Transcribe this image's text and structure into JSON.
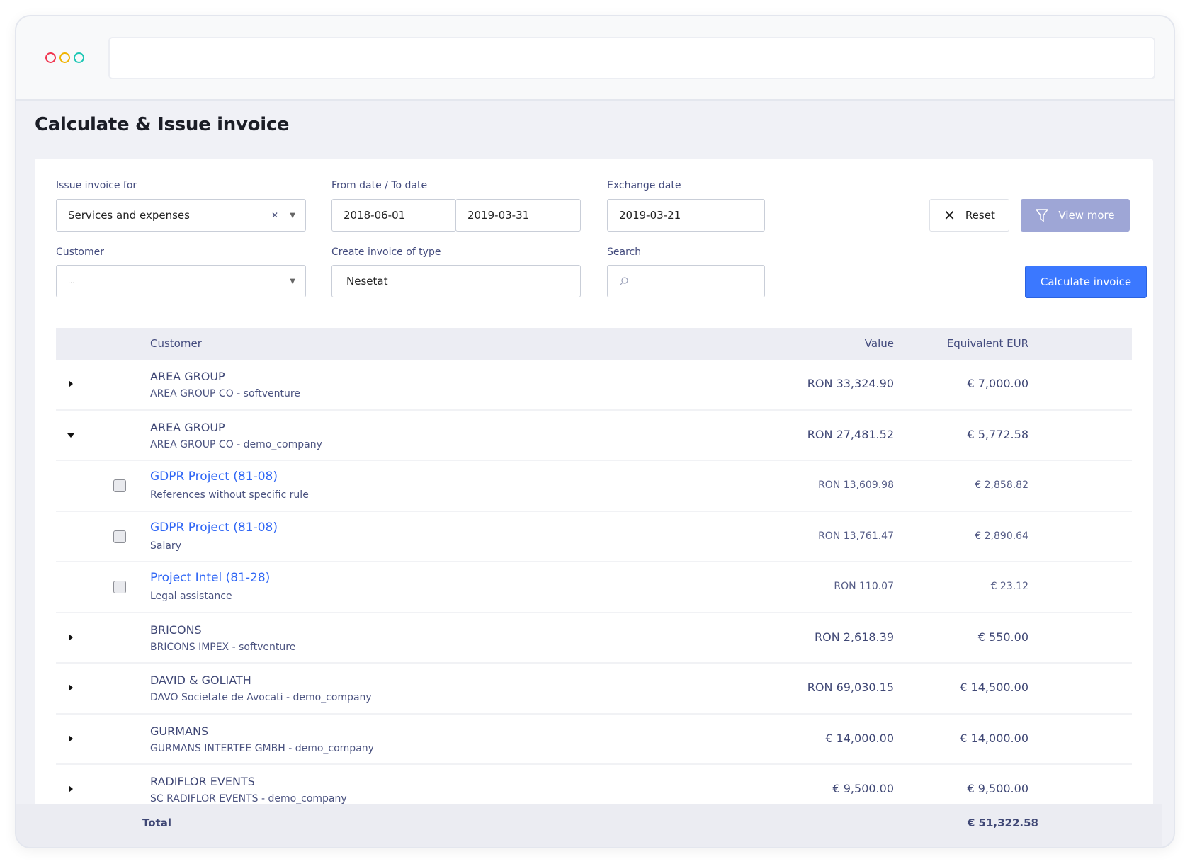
{
  "window": {
    "dot_colors": [
      "#f0354f",
      "#f0b300",
      "#1cc7b4"
    ]
  },
  "page": {
    "title": "Calculate & Issue invoice"
  },
  "filters": {
    "issue_for": {
      "label": "Issue invoice for",
      "value": "Services and expenses"
    },
    "dates": {
      "label": "From date / To date",
      "from": "2018-06-01",
      "to": "2019-03-31"
    },
    "exchange": {
      "label": "Exchange date",
      "value": "2019-03-21"
    },
    "customer": {
      "label": "Customer",
      "value": "..."
    },
    "type": {
      "label": "Create invoice of type",
      "value": "Nesetat"
    },
    "search": {
      "label": "Search",
      "value": ""
    },
    "reset_label": "Reset",
    "view_more_label": "View more",
    "calculate_label": "Calculate invoice"
  },
  "table": {
    "headers": {
      "customer": "Customer",
      "value": "Value",
      "eur": "Equivalent EUR"
    },
    "rows": [
      {
        "kind": "group",
        "expanded": false,
        "name": "AREA GROUP",
        "sub": "AREA GROUP CO - softventure",
        "value": "RON 33,324.90",
        "eur": "€ 7,000.00"
      },
      {
        "kind": "group",
        "expanded": true,
        "name": "AREA GROUP",
        "sub": "AREA GROUP CO - demo_company",
        "value": "RON 27,481.52",
        "eur": "€ 5,772.58"
      },
      {
        "kind": "child",
        "checked": false,
        "name": "GDPR Project (81-08)",
        "sub": "References without specific rule",
        "value": "RON 13,609.98",
        "eur": "€ 2,858.82"
      },
      {
        "kind": "child",
        "checked": false,
        "name": "GDPR Project (81-08)",
        "sub": "Salary",
        "value": "RON 13,761.47",
        "eur": "€ 2,890.64"
      },
      {
        "kind": "child",
        "checked": false,
        "name": "Project Intel (81-28)",
        "sub": "Legal assistance",
        "value": "RON 110.07",
        "eur": "€ 23.12"
      },
      {
        "kind": "group",
        "expanded": false,
        "name": "BRICONS",
        "sub": "BRICONS IMPEX - softventure",
        "value": "RON 2,618.39",
        "eur": "€ 550.00"
      },
      {
        "kind": "group",
        "expanded": false,
        "name": "DAVID & GOLIATH",
        "sub": "DAVO Societate de Avocati - demo_company",
        "value": "RON 69,030.15",
        "eur": "€ 14,500.00"
      },
      {
        "kind": "group",
        "expanded": false,
        "name": "GURMANS",
        "sub": "GURMANS INTERTEE GMBH - demo_company",
        "value": "€ 14,000.00",
        "eur": "€ 14,000.00"
      },
      {
        "kind": "group",
        "expanded": false,
        "name": "RADIFLOR EVENTS",
        "sub": "SC RADIFLOR EVENTS - demo_company",
        "value": "€ 9,500.00",
        "eur": "€ 9,500.00"
      }
    ],
    "total": {
      "label": "Total",
      "eur": "€ 51,322.58"
    }
  },
  "colors": {
    "primary": "#3b78ff",
    "view_more": "#9ea6d6",
    "text": "#3f4775",
    "link": "#2f66f5"
  }
}
